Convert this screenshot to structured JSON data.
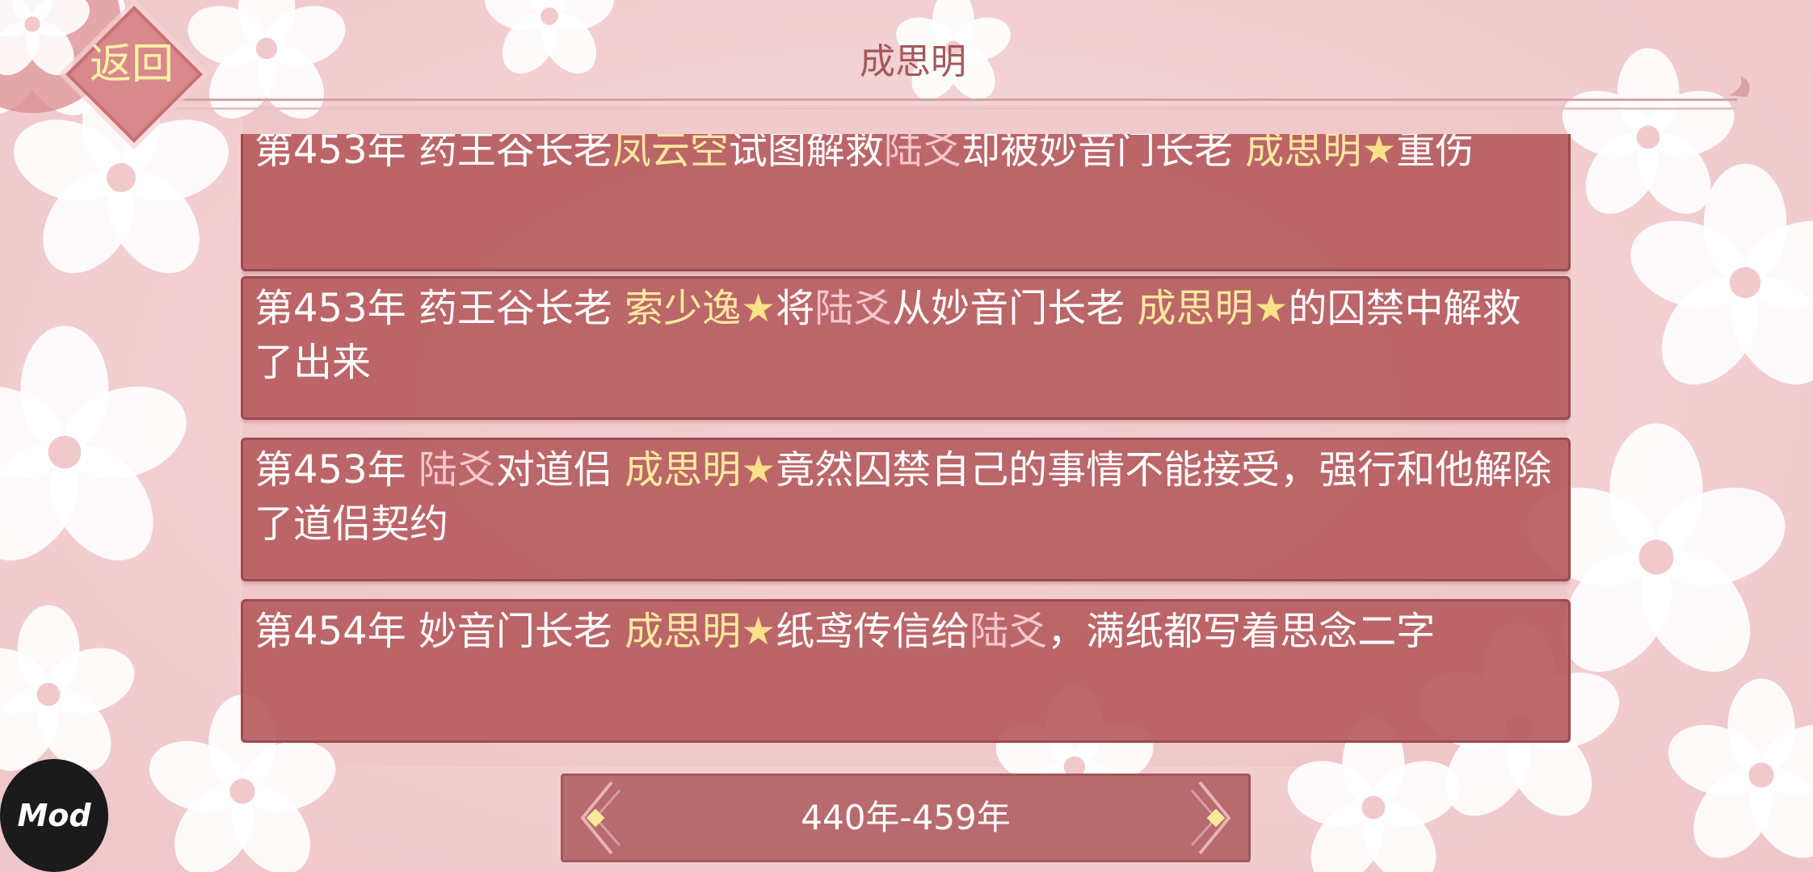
{
  "header": {
    "title": "成思明",
    "back_label": "返回"
  },
  "events": [
    {
      "segments": [
        {
          "text": "第453年 药王谷长老",
          "style": "w"
        },
        {
          "text": "凤云空",
          "style": "y"
        },
        {
          "text": "试图解救",
          "style": "w"
        },
        {
          "text": "陆爻",
          "style": "p"
        },
        {
          "text": "却被妙音门长老 ",
          "style": "w"
        },
        {
          "text": "成思明",
          "style": "y"
        },
        {
          "text": "★",
          "style": "star"
        },
        {
          "text": "重伤",
          "style": "w"
        }
      ]
    },
    {
      "segments": [
        {
          "text": "第453年 药王谷长老 ",
          "style": "w"
        },
        {
          "text": "索少逸",
          "style": "y"
        },
        {
          "text": "★",
          "style": "star"
        },
        {
          "text": "将",
          "style": "w"
        },
        {
          "text": "陆爻",
          "style": "p"
        },
        {
          "text": "从妙音门长老 ",
          "style": "w"
        },
        {
          "text": "成思明",
          "style": "y"
        },
        {
          "text": "★",
          "style": "star"
        },
        {
          "text": "的囚禁中解救了出来",
          "style": "w"
        }
      ]
    },
    {
      "segments": [
        {
          "text": "第453年 ",
          "style": "w"
        },
        {
          "text": "陆爻",
          "style": "p"
        },
        {
          "text": "对道侣 ",
          "style": "w"
        },
        {
          "text": "成思明",
          "style": "y"
        },
        {
          "text": "★",
          "style": "star"
        },
        {
          "text": "竟然囚禁自己的事情不能接受，强行和他解除了道侣契约",
          "style": "w"
        }
      ]
    },
    {
      "segments": [
        {
          "text": "第454年 妙音门长老 ",
          "style": "w"
        },
        {
          "text": "成思明",
          "style": "y"
        },
        {
          "text": "★",
          "style": "star"
        },
        {
          "text": "纸鸢传信给",
          "style": "w"
        },
        {
          "text": "陆爻",
          "style": "p"
        },
        {
          "text": "，满纸都写着思念二字",
          "style": "w"
        }
      ]
    }
  ],
  "nav": {
    "range": "440年-459年",
    "prev_icon": "arrow-left-icon",
    "next_icon": "arrow-right-icon"
  },
  "badge": {
    "label": "Mod"
  },
  "colors": {
    "card": "#b75e61",
    "highlight_yellow": "#fde89c",
    "highlight_pink": "#f5c7cb",
    "title": "#a2585a"
  }
}
